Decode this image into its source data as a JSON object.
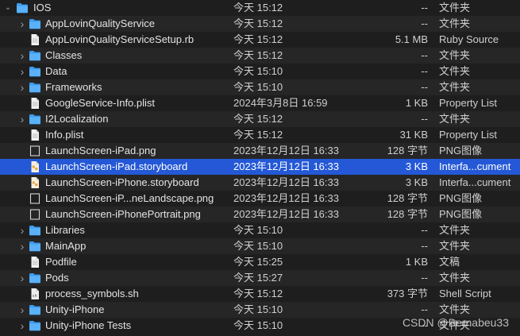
{
  "rows": [
    {
      "name": "IOS",
      "date": "今天 15:12",
      "size": "--",
      "kind": "文件夹",
      "type": "folder",
      "disclosure": "expanded",
      "level": 0
    },
    {
      "name": "AppLovinQualityService",
      "date": "今天 15:12",
      "size": "--",
      "kind": "文件夹",
      "type": "folder",
      "disclosure": "collapsed",
      "level": 1
    },
    {
      "name": "AppLovinQualityServiceSetup.rb",
      "date": "今天 15:12",
      "size": "5.1 MB",
      "kind": "Ruby Source",
      "type": "file",
      "level": 1
    },
    {
      "name": "Classes",
      "date": "今天 15:12",
      "size": "--",
      "kind": "文件夹",
      "type": "folder",
      "disclosure": "collapsed",
      "level": 1
    },
    {
      "name": "Data",
      "date": "今天 15:10",
      "size": "--",
      "kind": "文件夹",
      "type": "folder",
      "disclosure": "collapsed",
      "level": 1
    },
    {
      "name": "Frameworks",
      "date": "今天 15:10",
      "size": "--",
      "kind": "文件夹",
      "type": "folder",
      "disclosure": "collapsed",
      "level": 1
    },
    {
      "name": "GoogleService-Info.plist",
      "date": "2024年3月8日 16:59",
      "size": "1 KB",
      "kind": "Property List",
      "type": "file",
      "level": 1
    },
    {
      "name": "I2Localization",
      "date": "今天 15:12",
      "size": "--",
      "kind": "文件夹",
      "type": "folder",
      "disclosure": "collapsed",
      "level": 1
    },
    {
      "name": "Info.plist",
      "date": "今天 15:12",
      "size": "31 KB",
      "kind": "Property List",
      "type": "file",
      "level": 1
    },
    {
      "name": "LaunchScreen-iPad.png",
      "date": "2023年12月12日 16:33",
      "size": "128 字节",
      "kind": "PNG图像",
      "type": "image",
      "level": 1
    },
    {
      "name": "LaunchScreen-iPad.storyboard",
      "date": "2023年12月12日 16:33",
      "size": "3 KB",
      "kind": "Interfa...cument",
      "type": "storyboard",
      "level": 1,
      "selected": true
    },
    {
      "name": "LaunchScreen-iPhone.storyboard",
      "date": "2023年12月12日 16:33",
      "size": "3 KB",
      "kind": "Interfa...cument",
      "type": "storyboard",
      "level": 1
    },
    {
      "name": "LaunchScreen-iP...neLandscape.png",
      "date": "2023年12月12日 16:33",
      "size": "128 字节",
      "kind": "PNG图像",
      "type": "image",
      "level": 1
    },
    {
      "name": "LaunchScreen-iPhonePortrait.png",
      "date": "2023年12月12日 16:33",
      "size": "128 字节",
      "kind": "PNG图像",
      "type": "image",
      "level": 1
    },
    {
      "name": "Libraries",
      "date": "今天 15:10",
      "size": "--",
      "kind": "文件夹",
      "type": "folder",
      "disclosure": "collapsed",
      "level": 1
    },
    {
      "name": "MainApp",
      "date": "今天 15:10",
      "size": "--",
      "kind": "文件夹",
      "type": "folder",
      "disclosure": "collapsed",
      "level": 1
    },
    {
      "name": "Podfile",
      "date": "今天 15:25",
      "size": "1 KB",
      "kind": "文稿",
      "type": "file",
      "level": 1
    },
    {
      "name": "Pods",
      "date": "今天 15:27",
      "size": "--",
      "kind": "文件夹",
      "type": "folder",
      "disclosure": "collapsed",
      "level": 1
    },
    {
      "name": "process_symbols.sh",
      "date": "今天 15:12",
      "size": "373 字节",
      "kind": "Shell Script",
      "type": "script",
      "level": 1
    },
    {
      "name": "Unity-iPhone",
      "date": "今天 15:10",
      "size": "--",
      "kind": "文件夹",
      "type": "folder",
      "disclosure": "collapsed",
      "level": 1
    },
    {
      "name": "Unity-iPhone Tests",
      "date": "今天 15:10",
      "size": "--",
      "kind": "文件夹",
      "type": "folder",
      "disclosure": "collapsed",
      "level": 1
    }
  ],
  "watermark": "CSDN @Bernabeu33",
  "colors": {
    "accent": "#2458d6",
    "folder": "#3d9cf0",
    "background": "#1e1e1e"
  }
}
